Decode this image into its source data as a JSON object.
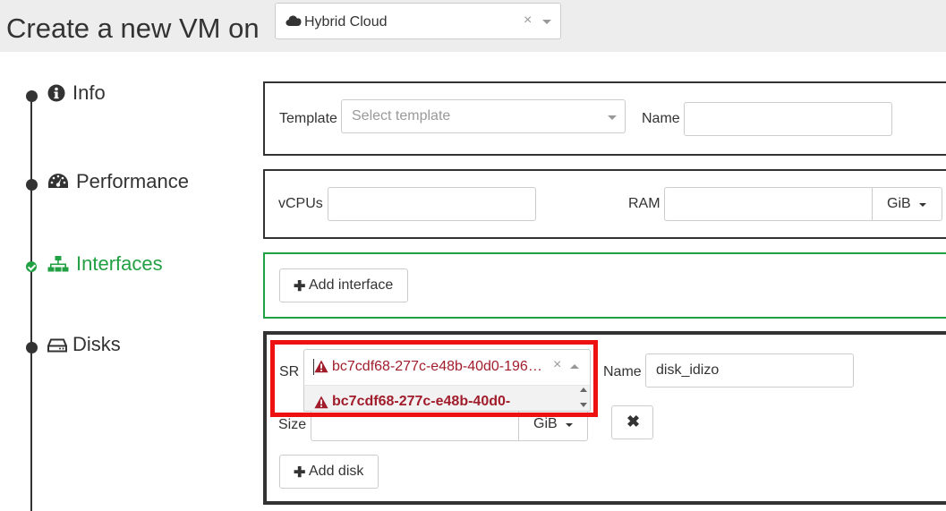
{
  "header": {
    "title": "Create a new VM on",
    "pool": {
      "icon": "cloud-icon",
      "value": "Hybrid Cloud"
    }
  },
  "steps": [
    {
      "label": "Info",
      "icon": "info-circle-icon",
      "state": "default"
    },
    {
      "label": "Performance",
      "icon": "dashboard-icon",
      "state": "default"
    },
    {
      "label": "Interfaces",
      "icon": "sitemap-icon",
      "state": "success"
    },
    {
      "label": "Disks",
      "icon": "hdd-icon",
      "state": "default"
    }
  ],
  "info": {
    "template_label": "Template",
    "template_placeholder": "Select template",
    "name_label": "Name",
    "name_value": ""
  },
  "performance": {
    "vcpus_label": "vCPUs",
    "vcpus_value": "",
    "ram_label": "RAM",
    "ram_value": "",
    "ram_unit": "GiB"
  },
  "interfaces": {
    "add_label": "Add interface"
  },
  "disks": {
    "sr_label": "SR",
    "sr_selected": "bc7cdf68-277c-e48b-40d0-196…",
    "sr_option": "bc7cdf68-277c-e48b-40d0-",
    "name_label": "Name",
    "name_value": "disk_idizo",
    "size_label": "Size",
    "size_value": "",
    "size_unit": "GiB",
    "remove_icon": "close-icon",
    "add_label": "Add disk"
  },
  "colors": {
    "success": "#22a044",
    "warning_text": "#a11d2c",
    "highlight": "#ee1111"
  }
}
